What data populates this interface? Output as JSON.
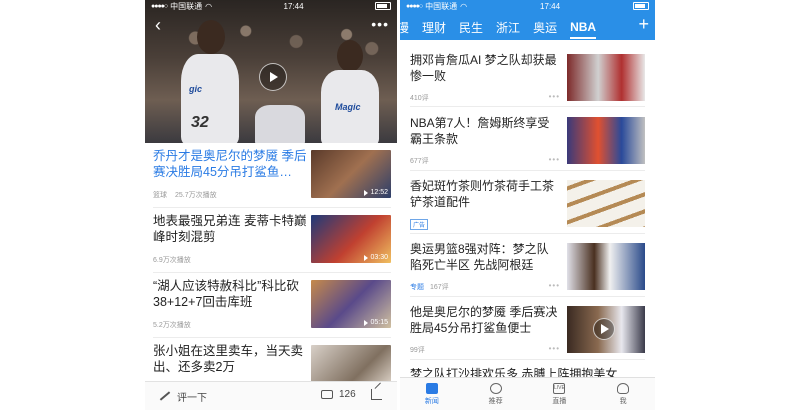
{
  "left_phone": {
    "status": {
      "carrier": "中国联通",
      "time": "17:44"
    },
    "feed": [
      {
        "title": "乔丹才是奥尼尔的梦魇 季后赛决胜局45分吊打鲨鱼…",
        "tag": "篮球",
        "plays": "25.7万次播放",
        "duration": "12:52",
        "active": true
      },
      {
        "title": "地表最强兄弟连 麦蒂卡特巅峰时刻混剪",
        "tag": "",
        "plays": "6.9万次播放",
        "duration": "03:30",
        "active": false
      },
      {
        "title": "“湖人应该特赦科比”科比砍38+12+7回击库班",
        "tag": "",
        "plays": "5.2万次播放",
        "duration": "05:15",
        "active": false
      },
      {
        "title": "张小姐在这里卖车，当天卖出、还多卖2万",
        "tag": "",
        "plays": "",
        "duration": "",
        "active": false
      }
    ],
    "bottom": {
      "comment_prompt": "评一下",
      "comment_count": "126"
    }
  },
  "right_phone": {
    "status": {
      "carrier": "中国联通",
      "time": "17:44"
    },
    "tabs": [
      "漫",
      "理财",
      "民生",
      "浙江",
      "奥运",
      "NBA"
    ],
    "active_tab": "NBA",
    "plus": "+",
    "feed": [
      {
        "title": "拥邓肯詹瓜AI 梦之队却获最惨一败",
        "badge": "",
        "comments": "410评"
      },
      {
        "title": "NBA第7人！詹姆斯终享受霸王条款",
        "badge": "",
        "comments": "677评"
      },
      {
        "title": "香妃斑竹茶则竹茶荷手工茶铲茶道配件",
        "badge": "广告",
        "comments": ""
      },
      {
        "title": "奥运男篮8强对阵：梦之队陷死亡半区 先战阿根廷",
        "badge": "专题",
        "comments": "167评"
      },
      {
        "title": "他是奥尼尔的梦魇 季后赛决胜局45分吊打鲨鱼便士",
        "badge": "",
        "comments": "99评"
      },
      {
        "title": "梦之队打沙排欢乐多 赤膊上阵拥抱美女",
        "badge": "",
        "comments": ""
      }
    ],
    "nav": [
      {
        "label": "新闻",
        "icon": "news-icon",
        "active": true
      },
      {
        "label": "推荐",
        "icon": "heart-icon",
        "active": false
      },
      {
        "label": "直播",
        "icon": "live-icon",
        "active": false
      },
      {
        "label": "我",
        "icon": "user-icon",
        "active": false
      }
    ],
    "nav_live_icon_text": "LIVE"
  },
  "colors": {
    "accent": "#2a8fe7",
    "active_text": "#2a7be4"
  }
}
